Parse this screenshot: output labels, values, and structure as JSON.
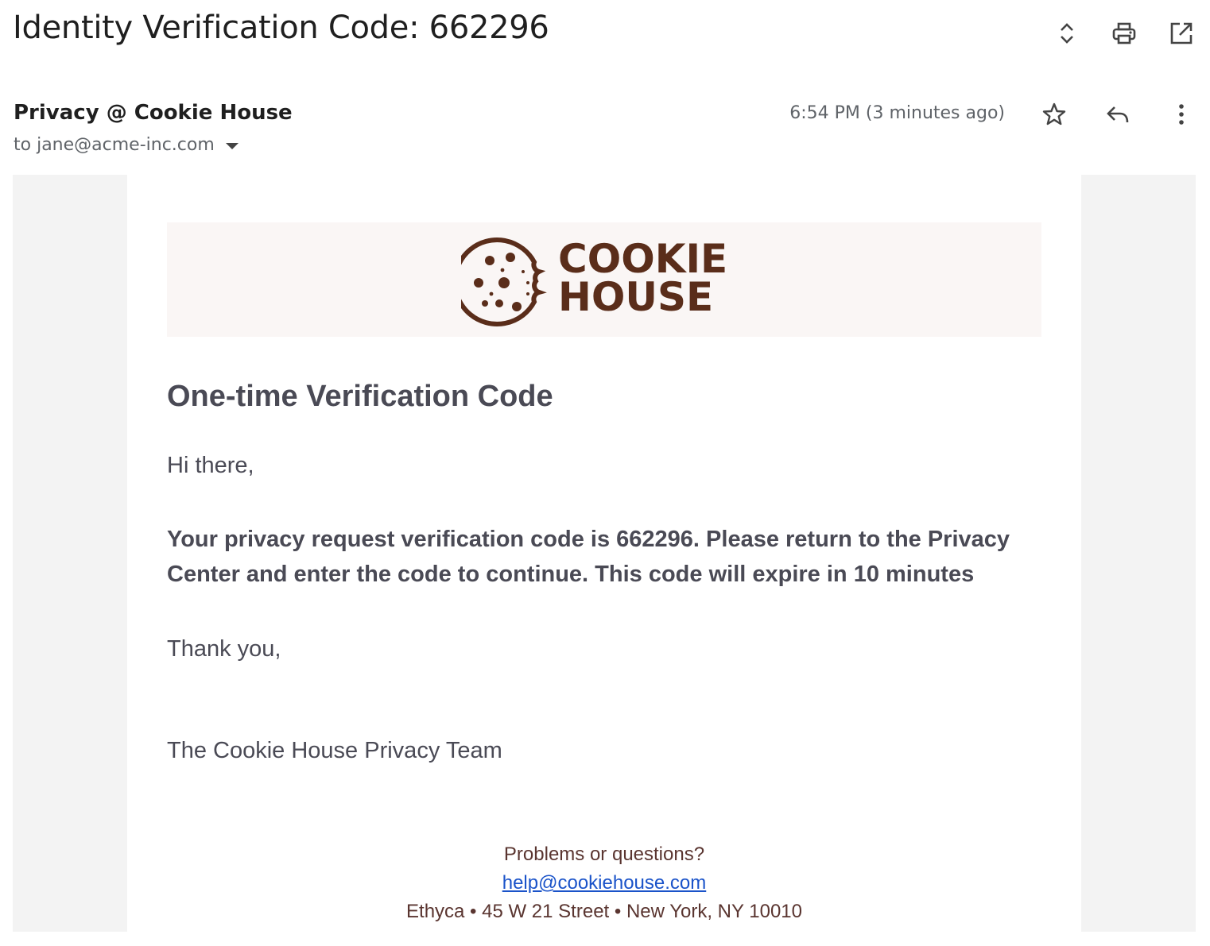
{
  "subject": "Identity Verification Code: 662296",
  "sender": {
    "name": "Privacy @ Cookie House",
    "to": "to jane@acme-inc.com"
  },
  "timestamp": "6:54 PM (3 minutes ago)",
  "icons": {
    "top": [
      "expand-collapse-icon",
      "print-icon",
      "open-in-new-window-icon"
    ],
    "message": [
      "star-icon",
      "reply-icon",
      "more-options-icon"
    ]
  },
  "email": {
    "logo": {
      "line1": "COOKIE",
      "line2": "HOUSE",
      "color": "#5a2d1a"
    },
    "heading": "One-time Verification Code",
    "greeting": "Hi there,",
    "body": "Your privacy request verification code is 662296. Please return to the Privacy Center and enter the code to continue. This code will expire in 10 minutes",
    "thanks": "Thank you,",
    "signature": "The Cookie House Privacy Team",
    "footer": {
      "question": "Problems or questions?",
      "email": "help@cookiehouse.com",
      "address": "Ethyca • 45 W 21 Street • New York, NY 10010"
    }
  }
}
